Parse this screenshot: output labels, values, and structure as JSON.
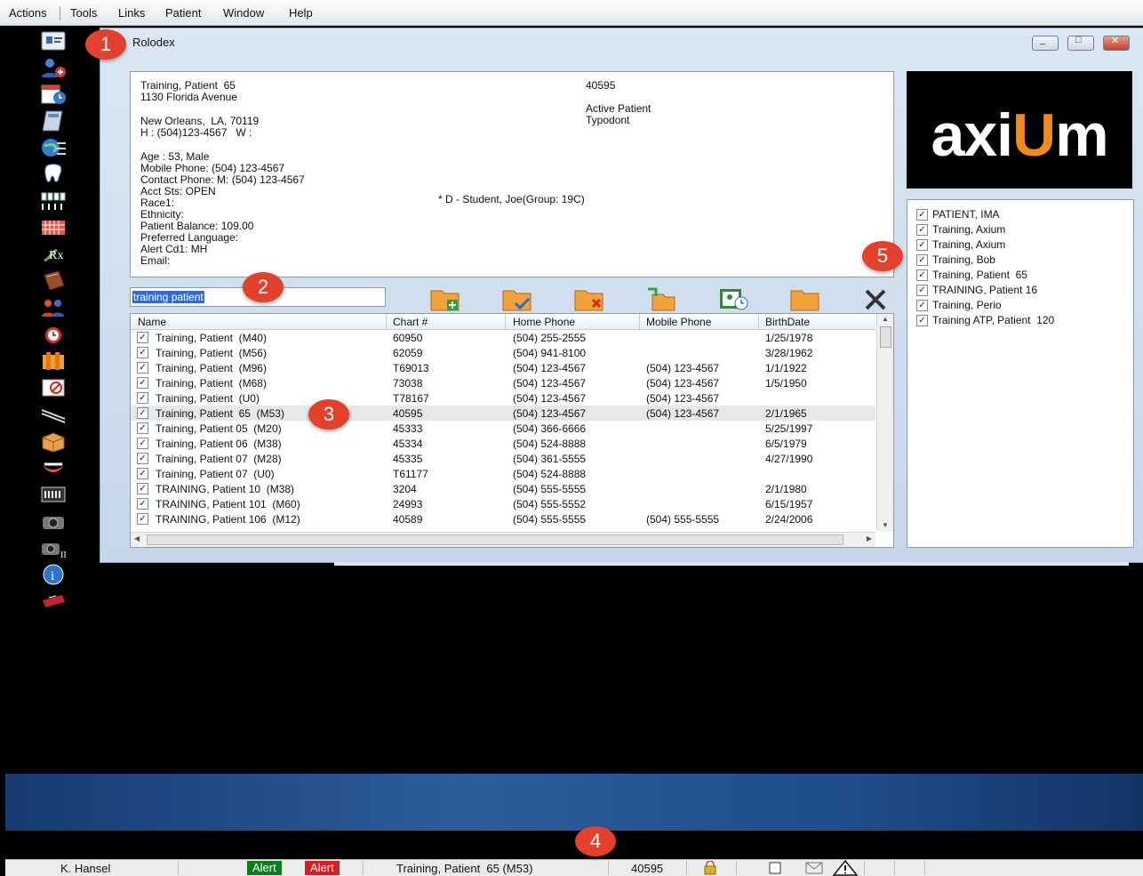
{
  "menubar": {
    "items": [
      "Actions",
      "Tools",
      "Links",
      "Patient",
      "Window",
      "Help"
    ]
  },
  "window": {
    "title": "Rolodex"
  },
  "details": {
    "name_line": "Training, Patient  65",
    "address": "1130 Florida Avenue",
    "city": "New Orleans,  LA, 70119",
    "phones": "H : (504)123-4567   W :",
    "age": "Age : 53, Male",
    "mobile": "Mobile Phone: (504) 123-4567",
    "contact": "Contact Phone: M: (504) 123-4567",
    "acct": "Acct Sts: OPEN",
    "race": "Race1:",
    "ethnicity": "Ethnicity:",
    "balance": "Patient Balance: 109.00",
    "language": "Preferred Language:",
    "alert": "Alert Cd1: MH",
    "email": "Email:",
    "chart": "40595",
    "active": "Active Patient",
    "typodont": "Typodont",
    "provider": "* D - Student, Joe(Group: 19C)"
  },
  "search": {
    "value": "training patient"
  },
  "toolbar": {
    "icons": [
      "add-folder-icon",
      "edit-folder-icon",
      "delete-folder-icon",
      "move-folder-icon",
      "appointment-icon",
      "open-folder-icon",
      "tools-icon"
    ]
  },
  "grid": {
    "columns": [
      "Name",
      "Chart #",
      "Home Phone",
      "Mobile Phone",
      "BirthDate"
    ],
    "rows": [
      {
        "name": "Training, Patient  (M40)",
        "chart": "60950",
        "home": "(504) 255-2555",
        "mobile": "",
        "birth": "1/25/1978"
      },
      {
        "name": "Training, Patient  (M56)",
        "chart": "62059",
        "home": "(504) 941-8100",
        "mobile": "",
        "birth": "3/28/1962"
      },
      {
        "name": "Training, Patient  (M96)",
        "chart": "T69013",
        "home": "(504) 123-4567",
        "mobile": "(504) 123-4567",
        "birth": "1/1/1922"
      },
      {
        "name": "Training, Patient  (M68)",
        "chart": "73038",
        "home": "(504) 123-4567",
        "mobile": "(504) 123-4567",
        "birth": "1/5/1950"
      },
      {
        "name": "Training, Patient  (U0)",
        "chart": "T78167",
        "home": "(504) 123-4567",
        "mobile": "(504) 123-4567",
        "birth": ""
      },
      {
        "name": "Training, Patient  65  (M53)",
        "chart": "40595",
        "home": "(504) 123-4567",
        "mobile": "(504) 123-4567",
        "birth": "2/1/1965"
      },
      {
        "name": "Training, Patient 05  (M20)",
        "chart": "45333",
        "home": "(504) 366-6666",
        "mobile": "",
        "birth": "5/25/1997"
      },
      {
        "name": "Training, Patient 06  (M38)",
        "chart": "45334",
        "home": "(504) 524-8888",
        "mobile": "",
        "birth": "6/5/1979"
      },
      {
        "name": "Training, Patient 07  (M28)",
        "chart": "45335",
        "home": "(504) 361-5555",
        "mobile": "",
        "birth": "4/27/1990"
      },
      {
        "name": "Training, Patient 07  (U0)",
        "chart": "T61177",
        "home": "(504) 524-8888",
        "mobile": "",
        "birth": ""
      },
      {
        "name": "TRAINING, Patient 10  (M38)",
        "chart": "3204",
        "home": "(504) 555-5555",
        "mobile": "",
        "birth": "2/1/1980"
      },
      {
        "name": "TRAINING, Patient 101  (M60)",
        "chart": "24993",
        "home": "(504) 555-5552",
        "mobile": "",
        "birth": "6/15/1957"
      },
      {
        "name": "TRAINING, Patient 106  (M12)",
        "chart": "40589",
        "home": "(504) 555-5555",
        "mobile": "(504) 555-5555",
        "birth": "2/24/2006"
      }
    ],
    "selected_index": 5
  },
  "logo": {
    "pre": "axi",
    "u": "U",
    "post": "m"
  },
  "patient_list": [
    "PATIENT, IMA",
    "Training, Axium",
    "Training, Axium",
    "Training, Bob",
    "Training, Patient  65",
    "TRAINING, Patient 16",
    "Training, Perio",
    "Training ATP, Patient  120"
  ],
  "statusbar": {
    "user": "K. Hansel",
    "alert1": "Alert",
    "alert2": "Alert",
    "patient": "Training, Patient  65 (M53)",
    "chart": "40595"
  },
  "callouts": [
    "1",
    "2",
    "3",
    "4",
    "5"
  ],
  "colors": {
    "accent": "#f18a1c",
    "callout": "#e4412d",
    "alert_green": "#0a7d1c",
    "alert_red": "#d71d1d"
  }
}
